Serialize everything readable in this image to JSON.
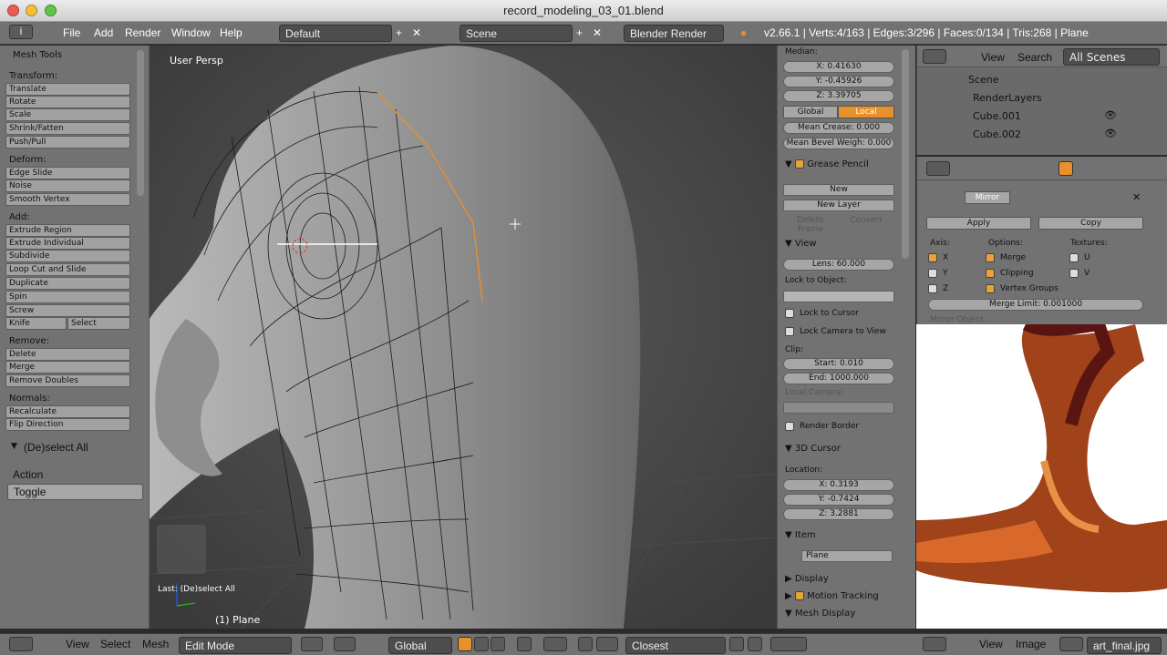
{
  "window": {
    "title": "record_modeling_03_01.blend"
  },
  "info_header": {
    "menus": [
      "File",
      "Add",
      "Render",
      "Window",
      "Help"
    ],
    "screen_layout": "Default",
    "scene": "Scene",
    "engine": "Blender Render",
    "stats": "v2.66.1 | Verts:4/163 | Edges:3/296 | Faces:0/134 | Tris:268 | Plane"
  },
  "toolshelf": {
    "title": "Mesh Tools",
    "transform_label": "Transform:",
    "transform": [
      "Translate",
      "Rotate",
      "Scale",
      "Shrink/Fatten",
      "Push/Pull"
    ],
    "deform_label": "Deform:",
    "deform": [
      "Edge Slide",
      "Noise",
      "Smooth Vertex"
    ],
    "add_label": "Add:",
    "add": [
      "Extrude Region",
      "Extrude Individual",
      "Subdivide",
      "Loop Cut and Slide",
      "Duplicate",
      "Spin",
      "Screw"
    ],
    "knife": "Knife",
    "select": "Select",
    "remove_label": "Remove:",
    "delete": "Delete",
    "remove": [
      "Merge",
      "Remove Doubles"
    ],
    "normals_label": "Normals:",
    "normals": [
      "Recalculate",
      "Flip Direction"
    ]
  },
  "operator_panel": {
    "title": "(De)select All",
    "action_label": "Action",
    "action_value": "Toggle"
  },
  "viewport": {
    "view_name": "User Persp",
    "last_op": "Last: (De)select All",
    "object_label": "(1) Plane"
  },
  "properties": {
    "median_label": "Median:",
    "x": "X: 0.41630",
    "y": "Y: -0.45926",
    "z": "Z: 3.39705",
    "global": "Global",
    "local": "Local",
    "mean_crease": "Mean Crease: 0.000",
    "mean_bevel": "Mean Bevel Weigh: 0.000",
    "grease_pencil": "Grease Pencil",
    "new": "New",
    "new_layer": "New Layer",
    "delete_frame": "Delete Frame",
    "convert": "Convert",
    "view": "View",
    "lens": "Lens: 60.000",
    "lock_to_object": "Lock to Object:",
    "lock_to_cursor": "Lock to Cursor",
    "lock_camera": "Lock Camera to View",
    "clip": "Clip:",
    "clip_start": "Start: 0.010",
    "clip_end": "End: 1000.000",
    "local_camera": "Local Camera:",
    "render_border": "Render Border",
    "cursor_3d": "3D Cursor",
    "location": "Location:",
    "cx": "X: 0.3193",
    "cy": "Y: -0.7424",
    "cz": "Z: 3.2881",
    "item": "Item",
    "item_name": "Plane",
    "display": "Display",
    "motion_tracking": "Motion Tracking",
    "mesh_display": "Mesh Display"
  },
  "outliner": {
    "view": "View",
    "search": "Search",
    "filter": "All Scenes",
    "rows": [
      "Scene",
      "RenderLayers",
      "Cube.001",
      "Cube.002"
    ]
  },
  "modifier": {
    "name": "Mirror",
    "apply": "Apply",
    "copy": "Copy",
    "axis_label": "Axis:",
    "options_label": "Options:",
    "textures_label": "Textures:",
    "x": "X",
    "y": "Y",
    "z": "Z",
    "merge": "Merge",
    "clipping": "Clipping",
    "vertex_groups": "Vertex Groups",
    "u": "U",
    "v": "V",
    "merge_limit": "Merge Limit: 0.001000",
    "mirror_object": "Mirror Object:"
  },
  "bottom": {
    "view": "View",
    "select": "Select",
    "mesh": "Mesh",
    "mode": "Edit Mode",
    "orientation": "Global",
    "snap": "Closest",
    "img_view": "View",
    "img_image": "Image",
    "img_name": "art_final.jpg"
  },
  "colors": {
    "accent": "#e8902a",
    "header": "#727272",
    "viewport": "#3d3d3d"
  }
}
